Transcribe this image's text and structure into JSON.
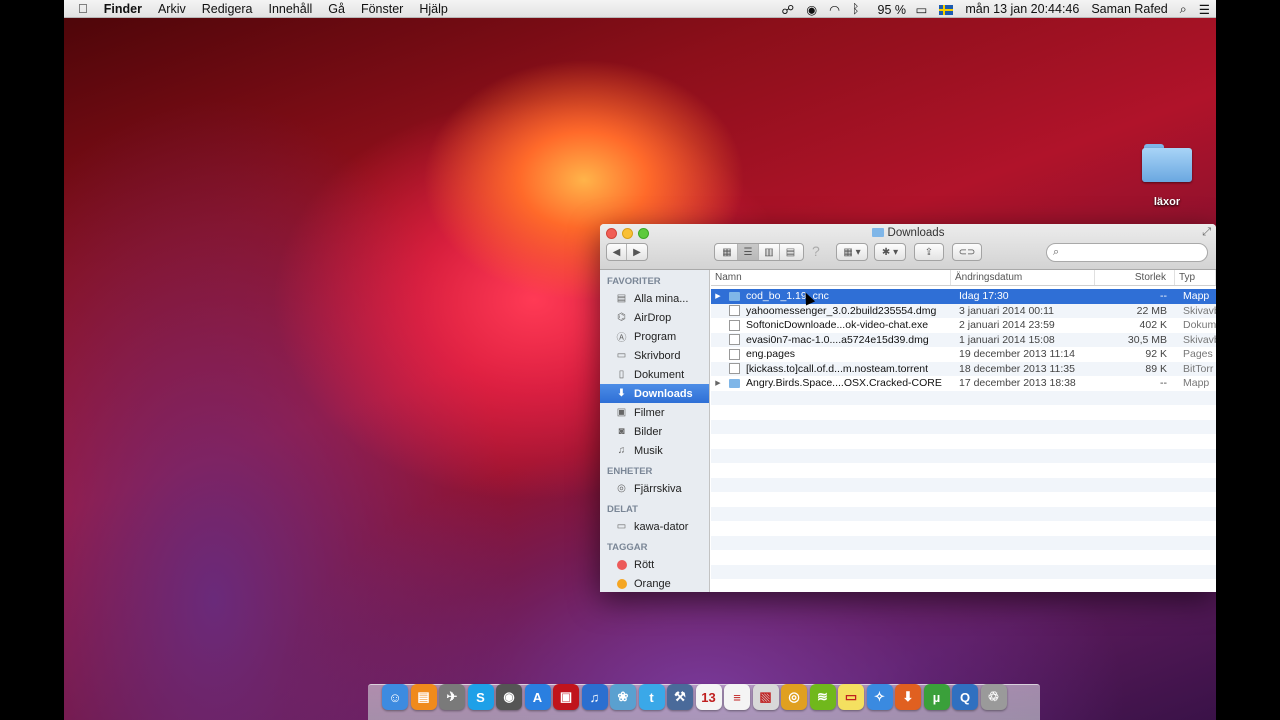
{
  "menubar": {
    "apple_icon": "apple-icon",
    "app_name": "Finder",
    "menus": [
      "Arkiv",
      "Redigera",
      "Innehåll",
      "Gå",
      "Fönster",
      "Hjälp"
    ],
    "battery": "95 %",
    "datetime": "mån 13 jan  20:44:46",
    "user": "Saman Rafed"
  },
  "desktop": {
    "folder_label": "läxor"
  },
  "window": {
    "title": "Downloads",
    "search_placeholder": ""
  },
  "sidebar": {
    "favorites_header": "FAVORITER",
    "favorites": [
      {
        "label": "Alla mina...",
        "icon": "all-files-icon"
      },
      {
        "label": "AirDrop",
        "icon": "airdrop-icon"
      },
      {
        "label": "Program",
        "icon": "applications-icon"
      },
      {
        "label": "Skrivbord",
        "icon": "desktop-icon"
      },
      {
        "label": "Dokument",
        "icon": "documents-icon"
      },
      {
        "label": "Downloads",
        "icon": "downloads-icon"
      },
      {
        "label": "Filmer",
        "icon": "movies-icon"
      },
      {
        "label": "Bilder",
        "icon": "pictures-icon"
      },
      {
        "label": "Musik",
        "icon": "music-icon"
      }
    ],
    "devices_header": "ENHETER",
    "devices": [
      {
        "label": "Fjärrskiva",
        "icon": "remote-disc-icon"
      }
    ],
    "shared_header": "DELAT",
    "shared": [
      {
        "label": "kawa-dator",
        "icon": "computer-icon"
      }
    ],
    "tags_header": "TAGGAR",
    "tags": [
      {
        "label": "Rött",
        "color": "#ec5a5a"
      },
      {
        "label": "Orange",
        "color": "#f5a623"
      }
    ]
  },
  "columns": {
    "name": "Namn",
    "date": "Ändringsdatum",
    "size": "Storlek",
    "type": "Typ"
  },
  "files": [
    {
      "name": "cod_bo_1.19_cnc",
      "date": "Idag 17:30",
      "size": "--",
      "type": "Mapp"
    },
    {
      "name": "yahoomessenger_3.0.2build235554.dmg",
      "date": "3 januari 2014 00:11",
      "size": "22 MB",
      "type": "Skivavb"
    },
    {
      "name": "SoftonicDownloade...ok-video-chat.exe",
      "date": "2 januari 2014 23:59",
      "size": "402 K",
      "type": "Dokum"
    },
    {
      "name": "evasi0n7-mac-1.0....a5724e15d39.dmg",
      "date": "1 januari 2014 15:08",
      "size": "30,5 MB",
      "type": "Skivavb"
    },
    {
      "name": "eng.pages",
      "date": "19 december 2013 11:14",
      "size": "92 K",
      "type": "Pages"
    },
    {
      "name": "[kickass.to]call.of.d...m.nosteam.torrent",
      "date": "18 december 2013 11:35",
      "size": "89 K",
      "type": "BitTorr"
    },
    {
      "name": "Angry.Birds.Space....OSX.Cracked-CORE",
      "date": "17 december 2013 18:38",
      "size": "--",
      "type": "Mapp"
    }
  ],
  "dock": {
    "apps": [
      {
        "icon": "finder-icon",
        "color": "#3d8be0",
        "glyph": "☺"
      },
      {
        "icon": "ibooks-icon",
        "color": "#f08a1c",
        "glyph": "▤"
      },
      {
        "icon": "launchpad-icon",
        "color": "#7a7a7a",
        "glyph": "✈"
      },
      {
        "icon": "skype-icon",
        "color": "#1ea0e8",
        "glyph": "S"
      },
      {
        "icon": "facetime-icon",
        "color": "#555",
        "glyph": "◉"
      },
      {
        "icon": "app-store-icon",
        "color": "#2a7fe0",
        "glyph": "A"
      },
      {
        "icon": "photo-booth-icon",
        "color": "#c0141c",
        "glyph": "▣"
      },
      {
        "icon": "itunes-icon",
        "color": "#2b6fd0",
        "glyph": "♫"
      },
      {
        "icon": "iphoto-icon",
        "color": "#5aa0d0",
        "glyph": "❀"
      },
      {
        "icon": "twitter-icon",
        "color": "#3aa8e8",
        "glyph": "t"
      },
      {
        "icon": "xcode-icon",
        "color": "#4a6a9a",
        "glyph": "⚒"
      },
      {
        "icon": "calendar-icon",
        "color": "#f4f4f4",
        "glyph": "13"
      },
      {
        "icon": "reminders-icon",
        "color": "#f4f4f4",
        "glyph": "≡"
      },
      {
        "icon": "preview-icon",
        "color": "#d8d8d8",
        "glyph": "▧"
      },
      {
        "icon": "chrome-icon",
        "color": "#e0a020",
        "glyph": "◎"
      },
      {
        "icon": "spotify-icon",
        "color": "#70b81c",
        "glyph": "≋"
      },
      {
        "icon": "stickies-icon",
        "color": "#f4e060",
        "glyph": "▭"
      },
      {
        "icon": "safari-icon",
        "color": "#3a8ae0",
        "glyph": "✧"
      },
      {
        "icon": "downloader-icon",
        "color": "#e06020",
        "glyph": "⬇"
      },
      {
        "icon": "utorrent-icon",
        "color": "#3aa03a",
        "glyph": "µ"
      },
      {
        "icon": "quicktime-icon",
        "color": "#3070c0",
        "glyph": "Q"
      },
      {
        "icon": "trash-icon",
        "color": "#9a9a9a",
        "glyph": "♲"
      }
    ]
  }
}
